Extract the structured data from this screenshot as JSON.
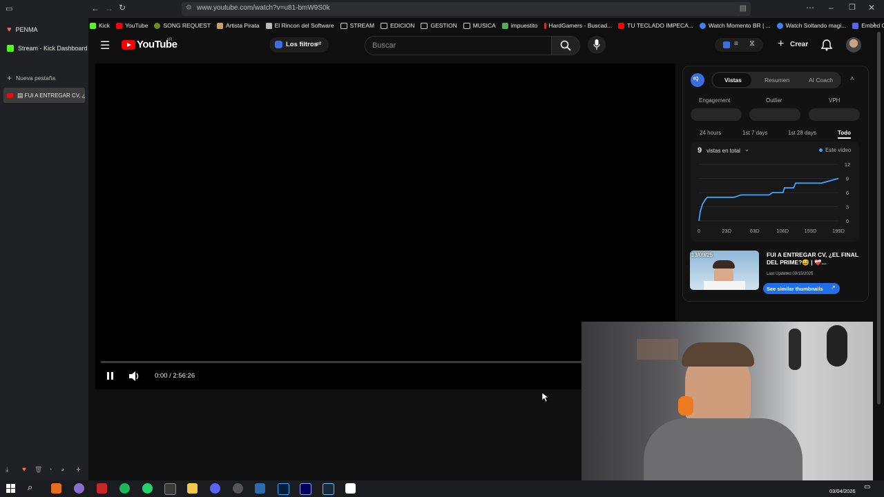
{
  "browser": {
    "url": "www.youtube.com/watch?v=u81-bmW9S0k",
    "bookmarks": [
      "Kick",
      "YouTube",
      "SONG REQUEST",
      "Artista Pirata",
      "El Rincon del Software",
      "STREAM",
      "EDICION",
      "GESTION",
      "MUSICA",
      "impuestito",
      "HardGamers - Buscad...",
      "TU TECLADO IMPECA...",
      "Watch Momento BR | ...",
      "Watch Soltando magi...",
      "Embed Generator"
    ],
    "sidebar": {
      "items": [
        {
          "label": "PENMA"
        },
        {
          "label": "Stream - Kick Dashboard"
        },
        {
          "label": "Nueva pestaña"
        },
        {
          "label": "FUI A ENTREGAR CV, ¿"
        }
      ]
    }
  },
  "youtube": {
    "logo_text": "YouTube",
    "region": "AR",
    "filters_label": "Los filtros",
    "search_placeholder": "Buscar",
    "create_label": "Crear"
  },
  "player": {
    "time": "0:00 / 2:56:26",
    "progress": 0.0
  },
  "panel": {
    "tabs": [
      "Vistas",
      "Resumen",
      "AI Coach"
    ],
    "active_tab": "Vistas",
    "metrics": [
      "Engagement",
      "Outlier",
      "VPH"
    ],
    "ranges": [
      "24 hours",
      "1st 7 days",
      "1st 28 days",
      "Todo"
    ],
    "active_range": "Todo",
    "views_count": "9",
    "views_label": "vistas en total",
    "legend": "Este video",
    "video_title": "FUI A ENTREGAR CV, ¿EL FINAL DEL PRIME?",
    "video_title_emojis": "😅 | ❤️‍🩹...",
    "thumb_date": "13/09/25",
    "last_updated": "Last Updated 09/15/2025",
    "similar_btn": "See similar thumbnails"
  },
  "chart_data": {
    "type": "line",
    "x_ticks": [
      "0",
      "23D",
      "63D",
      "106D",
      "155D",
      "199D"
    ],
    "y_ticks": [
      "12",
      "9",
      "6",
      "3",
      "0"
    ],
    "ylim": [
      0,
      12
    ],
    "xlim": [
      0,
      199
    ],
    "series": [
      {
        "color": "#3ea6ff",
        "x": [
          0,
          1,
          2,
          4,
          5,
          7,
          9,
          12,
          14,
          50,
          60,
          100,
          105,
          120,
          122,
          135,
          138,
          175,
          199
        ],
        "y": [
          0,
          1,
          2,
          3,
          3.5,
          4,
          4.5,
          5,
          5,
          5,
          5.5,
          5.5,
          6,
          6,
          7,
          7,
          8,
          8,
          9
        ]
      }
    ]
  },
  "taskbar": {
    "time": "03/04/2026"
  },
  "colors": {
    "accent": "#3ea6ff",
    "yt_red": "#ff0000",
    "kick_green": "#53fc18"
  }
}
